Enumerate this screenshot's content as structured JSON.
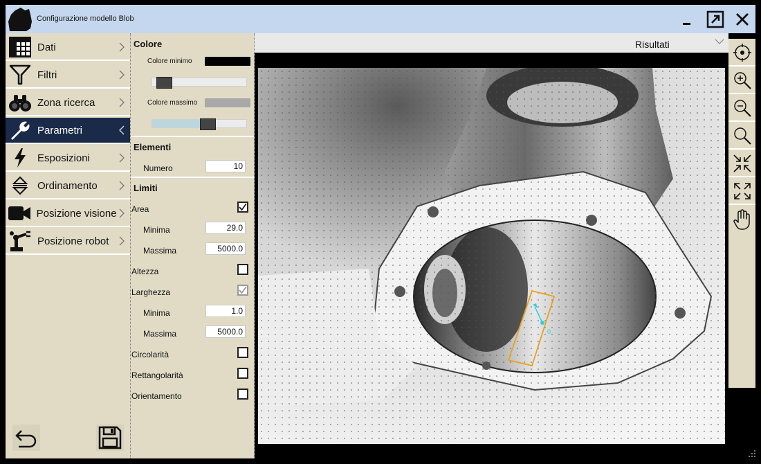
{
  "window": {
    "title": "Configurazione modello Blob"
  },
  "nav": {
    "items": [
      {
        "label": "Dati",
        "icon": "grid-icon",
        "active": false
      },
      {
        "label": "Filtri",
        "icon": "filter-icon",
        "active": false
      },
      {
        "label": "Zona ricerca",
        "icon": "binoculars-icon",
        "active": false
      },
      {
        "label": "Parametri",
        "icon": "wrench-icon",
        "active": true
      },
      {
        "label": "Esposizioni",
        "icon": "lightning-icon",
        "active": false
      },
      {
        "label": "Ordinamento",
        "icon": "sort-icon",
        "active": false
      },
      {
        "label": "Posizione visione",
        "icon": "camera-icon",
        "active": false
      },
      {
        "label": "Posizione robot",
        "icon": "robot-arm-icon",
        "active": false
      }
    ]
  },
  "panel": {
    "colore": {
      "title": "Colore",
      "min_label": "Colore minimo",
      "min_color": "#000000",
      "min_value": 0.05,
      "max_label": "Colore massimo",
      "max_color": "#a8a8a8",
      "max_value": 0.6
    },
    "elementi": {
      "title": "Elementi",
      "numero_label": "Numero",
      "numero_value": "10"
    },
    "limiti": {
      "title": "Limiti",
      "area_label": "Area",
      "area_checked": true,
      "area_min_label": "Minima",
      "area_min_value": "29.0",
      "area_max_label": "Massima",
      "area_max_value": "5000.0",
      "altezza_label": "Altezza",
      "altezza_checked": false,
      "larghezza_label": "Larghezza",
      "larghezza_checked": true,
      "larghezza_min_label": "Minima",
      "larghezza_min_value": "1.0",
      "larghezza_max_label": "Massima",
      "larghezza_max_value": "5000.0",
      "circolarita_label": "Circolarità",
      "circolarita_checked": false,
      "rettangolarita_label": "Rettangolarità",
      "rettangolarita_checked": false,
      "orientamento_label": "Orientamento",
      "orientamento_checked": false
    }
  },
  "viewer": {
    "results_label": "Risultati",
    "blob_label": "0"
  },
  "toolbar": {
    "tools": [
      "crosshair-icon",
      "zoom-in-icon",
      "zoom-out-icon",
      "zoom-fit-icon",
      "collapse-icon",
      "expand-icon",
      "pan-hand-icon"
    ]
  },
  "colors": {
    "titlebar": "#c5d7ee",
    "panel": "#e1dbc6",
    "active_nav": "#1a2b49",
    "blob_box": "#e8a21c",
    "marker": "#2fd0e0"
  }
}
